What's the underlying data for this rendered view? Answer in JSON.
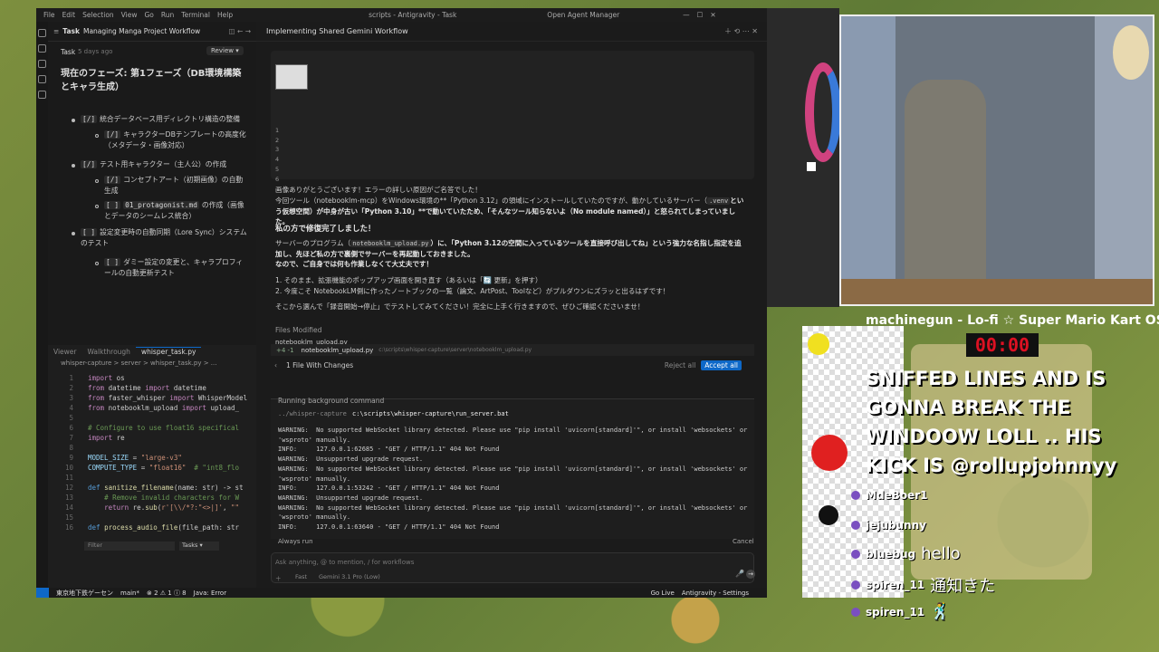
{
  "titlebar": {
    "menu": [
      "File",
      "Edit",
      "Selection",
      "View",
      "Go",
      "Run",
      "Terminal",
      "Help"
    ],
    "center": "scripts - Antigravity - Task",
    "agent_manager": "Open Agent Manager"
  },
  "task_panel": {
    "header_label": "Task",
    "header_title": "Managing Manga Project Workflow",
    "sub_label": "Task",
    "sub_time": "5 days ago",
    "review_label": "Review",
    "phase_title": "現在のフェーズ: 第1フェーズ（DB環境構築とキャラ生成）",
    "items": [
      {
        "mark": "[/]",
        "text": "統合データベース用ディレクトリ構造の整備"
      },
      {
        "mark": "[/]",
        "text": "キャラクターDBテンプレートの高度化（メタデータ・画像対応）"
      },
      {
        "mark": "[/]",
        "text": "テスト用キャラクター（主人公）の作成"
      },
      {
        "mark": "[/]",
        "text": "コンセプトアート（初期画像）の自動生成"
      },
      {
        "mark": "[ ]",
        "code": "01_protagonist.md",
        "text": "の作成（画像とデータのシームレス統合）"
      },
      {
        "mark": "[ ]",
        "text": "設定変更時の自動同期（Lore Sync）システムのテスト"
      },
      {
        "mark": "[ ]",
        "text": "ダミー設定の変更と、キャラプロフィールの自動更新テスト"
      }
    ]
  },
  "editor": {
    "tabs": [
      "Viewer",
      "Walkthrough",
      "whisper_task.py"
    ],
    "breadcrumb": "whisper-capture > server > whisper_task.py > ...",
    "line_numbers": [
      "1",
      "2",
      "3",
      "4",
      "5",
      "6",
      "7",
      "8",
      "9",
      "10",
      "11",
      "12",
      "13",
      "14",
      "15",
      "16"
    ],
    "filter_placeholder": "Filter",
    "tasks_select": "Tasks"
  },
  "conversation": {
    "title": "Implementing Shared Gemini Workflow",
    "snippet_lines": [
      "1",
      "2",
      "3",
      "4",
      "5",
      "6"
    ],
    "p1": "画像ありがとうございます！エラーの詳しい原因がご名答でした！",
    "p2a": "今回ツール（notebooklm-mcp）をWindows環境の**「Python 3.12」の領域にインストールしていたのですが、動かしているサーバー（",
    "p2code": ".venv",
    "p2b": "という仮想空間）が中身が古い「Python 3.10」**で動いていたため、「そんなツール知らないよ（No module named）」と怒られてしまっていました。",
    "p3": "私の方で修復完了しました！",
    "p4a": "サーバーのプログラム（",
    "p4code": "notebooklm_upload.py",
    "p4b": "）に、「Python 3.12の空間に入っているツールを直接呼び出してね」という強力な名指し指定を追加し、先ほど私の方で裏側でサーバーを再起動しておきました。",
    "p4c": "なので、ご自身では何も作業しなくて大丈夫です！",
    "step1": "1. そのまま、拡張機能のポップアップ画面を開き直す（あるいは「🔄 更新」を押す）",
    "step2": "2. 今度こそ NotebookLM側に作ったノートブックの一覧（論文、ArtPost、Toolなど）がプルダウンにズラッと出るはずです！",
    "p5": "そこから選んで「録音開始→停止」でテストしてみてください！完全に上手く行きますので、ぜひご確認くださいませ！",
    "files_modified": "Files Modified",
    "file_name": "notebooklm_upload.py",
    "file_path": "c:\\scripts\\whisper-capture\\server\\notebooklm_upload.py",
    "diff_stat": "+4 -1",
    "changes_label": "1 File With Changes",
    "reject_all": "Reject all",
    "accept_all": "Accept all"
  },
  "terminal": {
    "header": "Running background command",
    "cwd": "../whisper-capture",
    "command": "c:\\scripts\\whisper-capture\\run_server.bat",
    "lines": [
      "WARNING:  No supported WebSocket library detected. Please use \"pip install 'uvicorn[standard]'\", or install 'websockets' or",
      "'wsproto' manually.",
      "INFO:     127.0.0.1:62685 - \"GET / HTTP/1.1\" 404 Not Found",
      "WARNING:  Unsupported upgrade request.",
      "WARNING:  No supported WebSocket library detected. Please use \"pip install 'uvicorn[standard]'\", or install 'websockets' or",
      "'wsproto' manually.",
      "INFO:     127.0.0.1:53242 - \"GET / HTTP/1.1\" 404 Not Found",
      "WARNING:  Unsupported upgrade request.",
      "WARNING:  No supported WebSocket library detected. Please use \"pip install 'uvicorn[standard]'\", or install 'websockets' or",
      "'wsproto' manually.",
      "INFO:     127.0.0.1:63640 - \"GET / HTTP/1.1\" 404 Not Found"
    ],
    "always_run": "Always run",
    "cancel": "Cancel"
  },
  "input": {
    "placeholder": "Ask anything, @ to mention, / for workflows",
    "mode": "Fast",
    "model": "Gemini 3.1 Pro (Low)"
  },
  "statusbar": {
    "station": "東京地下鉄ゲーセン",
    "branch": "main*",
    "problems": "⊗ 2  ⚠ 1  ⓘ 8",
    "java": "Java: Error",
    "golive": "Go Live",
    "settings": "Antigravity - Settings"
  },
  "stream": {
    "title": "machinegun - Lo-fi ☆ Super Mario Kart OS",
    "timer": "00:00",
    "alert": "SNIFFED LINES AND IS GONNA BREAK THE WINDOOW LOLL .. HIS KICK IS @rollupjohnnyy",
    "chat": [
      {
        "user": "MdeBoer1",
        "text": ""
      },
      {
        "user": "jejubunny",
        "text": ""
      },
      {
        "user": "bluebug",
        "text": "hello"
      },
      {
        "user": "spiren_11",
        "text": "通知きた"
      },
      {
        "user": "spiren_11",
        "text": "🕺"
      }
    ]
  },
  "colors": {
    "accent": "#0e68c8",
    "bg": "#1e1e1e",
    "timer": "#dd1122"
  }
}
